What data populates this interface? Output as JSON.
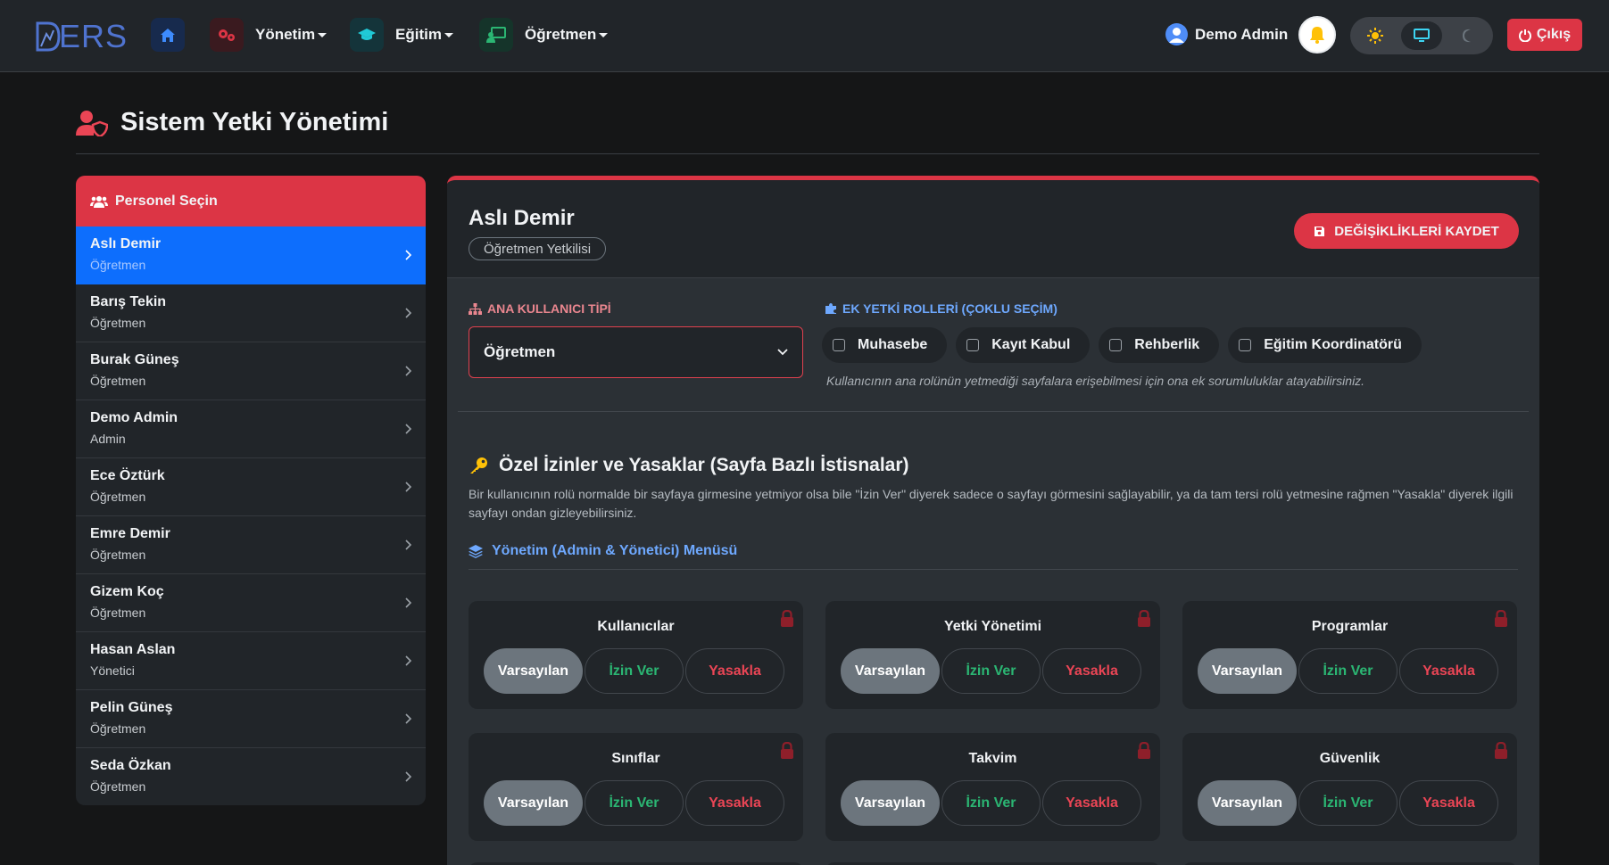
{
  "navbar": {
    "logo_text": "ERS",
    "menus": [
      {
        "label": "Yönetim",
        "icon": "gears-icon"
      },
      {
        "label": "Eğitim",
        "icon": "graduation-cap-icon"
      },
      {
        "label": "Öğretmen",
        "icon": "chalkboard-teacher-icon"
      }
    ],
    "user_name": "Demo Admin",
    "logout_label": "Çıkış",
    "theme_selected": "system"
  },
  "page": {
    "title": "Sistem Yetki Yönetimi"
  },
  "staff_panel": {
    "header": "Personel Seçin",
    "items": [
      {
        "name": "Aslı Demir",
        "role": "Öğretmen",
        "active": true
      },
      {
        "name": "Barış Tekin",
        "role": "Öğretmen"
      },
      {
        "name": "Burak Güneş",
        "role": "Öğretmen"
      },
      {
        "name": "Demo Admin",
        "role": "Admin"
      },
      {
        "name": "Ece Öztürk",
        "role": "Öğretmen"
      },
      {
        "name": "Emre Demir",
        "role": "Öğretmen"
      },
      {
        "name": "Gizem Koç",
        "role": "Öğretmen"
      },
      {
        "name": "Hasan Aslan",
        "role": "Yönetici"
      },
      {
        "name": "Pelin Güneş",
        "role": "Öğretmen"
      },
      {
        "name": "Seda Özkan",
        "role": "Öğretmen"
      }
    ]
  },
  "detail": {
    "name": "Aslı Demir",
    "badge": "Öğretmen Yetkilisi",
    "save_label": "DEĞİŞİKLİKLERİ KAYDET",
    "main_role_label": "ANA KULLANICI TİPİ",
    "main_role_value": "Öğretmen",
    "extra_roles_label": "EK YETKİ ROLLERİ (ÇOKLU SEÇİM)",
    "extra_roles": [
      "Muhasebe",
      "Kayıt Kabul",
      "Rehberlik",
      "Eğitim Koordinatörü"
    ],
    "extra_roles_hint": "Kullanıcının ana rolünün yetmediği sayfalara erişebilmesi için ona ek sorumluluklar atayabilirsiniz.",
    "special_title": "Özel İzinler ve Yasaklar (Sayfa Bazlı İstisnalar)",
    "special_desc": "Bir kullanıcının rolü normalde bir sayfaya girmesine yetmiyor olsa bile \"İzin Ver\" diyerek sadece o sayfayı görmesini sağlayabilir, ya da tam tersi rolü yetmesine rağmen \"Yasakla\" diyerek ilgili sayfayı ondan gizleyebilirsiniz.",
    "menu_label": "Yönetim (Admin & Yönetici) Menüsü",
    "options": {
      "default": "Varsayılan",
      "allow": "İzin Ver",
      "deny": "Yasakla"
    },
    "pages": [
      {
        "title": "Kullanıcılar",
        "selected": "default"
      },
      {
        "title": "Yetki Yönetimi",
        "selected": "default"
      },
      {
        "title": "Programlar",
        "selected": "default"
      },
      {
        "title": "Sınıflar",
        "selected": "default"
      },
      {
        "title": "Takvim",
        "selected": "default"
      },
      {
        "title": "Güvenlik",
        "selected": "default"
      }
    ]
  },
  "colors": {
    "accent_red": "#dc3545",
    "active_blue": "#0d6efd",
    "allow_green": "#2bb673",
    "deny_red": "#ea4555"
  }
}
